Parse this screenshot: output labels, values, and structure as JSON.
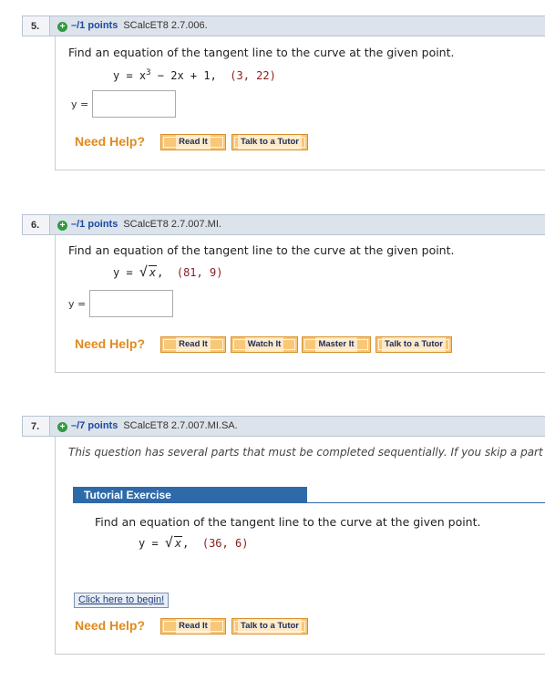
{
  "q5": {
    "number": "5.",
    "points": "–/1 points",
    "qid": "SCalcET8 2.7.006.",
    "prompt": "Find an equation of the tangent line to the curve at the given point.",
    "eq_lhs": "y = x",
    "eq_exp": "3",
    "eq_rhs": " − 2x + 1,",
    "point": "(3, 22)",
    "answer_label": "y =",
    "help": "Need Help?",
    "buttons": [
      "Read It",
      "Talk to a Tutor"
    ]
  },
  "q6": {
    "number": "6.",
    "points": "–/1 points",
    "qid": "SCalcET8 2.7.007.MI.",
    "prompt": "Find an equation of the tangent line to the curve at the given point.",
    "eq_lhs": "y =",
    "eq_arg": "x",
    "point": "(81, 9)",
    "answer_label": "y =",
    "help": "Need Help?",
    "buttons": [
      "Read It",
      "Watch It",
      "Master It",
      "Talk to a Tutor"
    ]
  },
  "q7": {
    "number": "7.",
    "points": "–/7 points",
    "qid": "SCalcET8 2.7.007.MI.SA.",
    "sequential_note": "This question has several parts that must be completed sequentially. If you skip a part o",
    "tutorial_title": "Tutorial Exercise",
    "prompt": "Find an equation of the tangent line to the curve at the given point.",
    "eq_lhs": "y =",
    "eq_arg": "x",
    "point": "(36, 6)",
    "begin_link": "Click here to begin!",
    "help": "Need Help?",
    "buttons": [
      "Read It",
      "Talk to a Tutor"
    ]
  },
  "colors": {
    "header_bg": "#dde3ea",
    "points_blue": "#1a4aa6",
    "help_orange": "#e08a1e",
    "tutorial_blue": "#2f6aa8",
    "point_red": "#8b1a1a"
  }
}
